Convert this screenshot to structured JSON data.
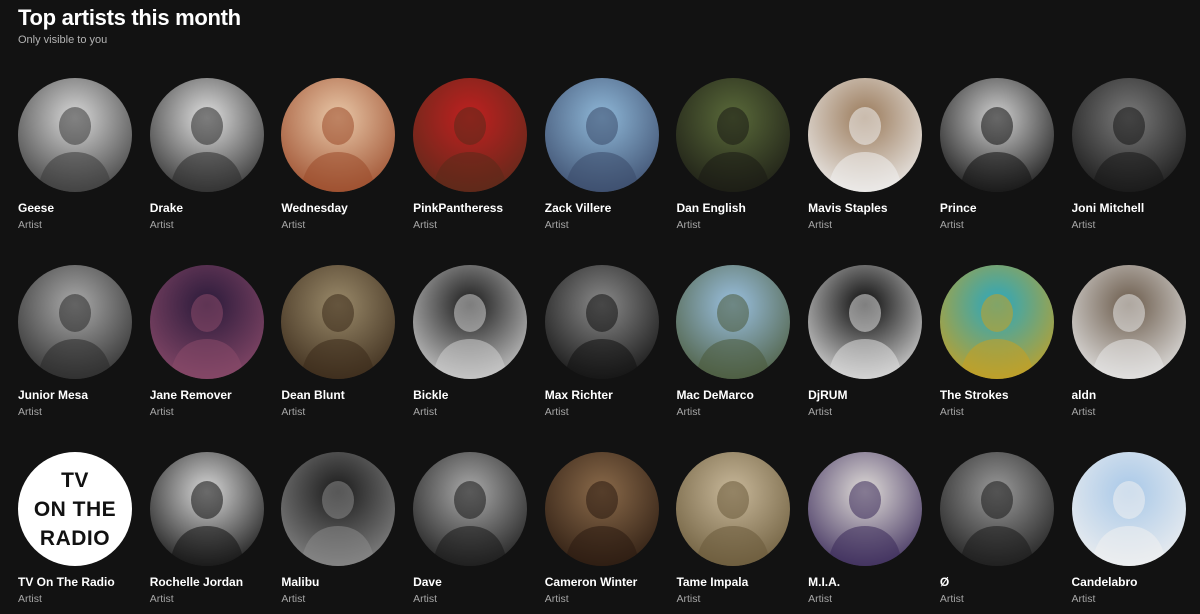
{
  "header": {
    "title": "Top artists this month",
    "subtitle": "Only visible to you"
  },
  "artists": [
    {
      "name": "Geese",
      "type": "Artist",
      "art": "photo",
      "colors": [
        "#d8d8d8",
        "#3a3a3a"
      ]
    },
    {
      "name": "Drake",
      "type": "Artist",
      "art": "photo",
      "colors": [
        "#e0e0e0",
        "#2a2a2a"
      ]
    },
    {
      "name": "Wednesday",
      "type": "Artist",
      "art": "photo",
      "colors": [
        "#e9c8a8",
        "#9a4a2a"
      ]
    },
    {
      "name": "PinkPantheress",
      "type": "Artist",
      "art": "photo",
      "colors": [
        "#c02020",
        "#5a2a1a"
      ]
    },
    {
      "name": "Zack Villere",
      "type": "Artist",
      "art": "photo",
      "colors": [
        "#8fb8d8",
        "#3a4a6a"
      ]
    },
    {
      "name": "Dan English",
      "type": "Artist",
      "art": "photo",
      "colors": [
        "#5a6a3a",
        "#1a1a14"
      ]
    },
    {
      "name": "Mavis Staples",
      "type": "Artist",
      "art": "photo",
      "colors": [
        "#9a7a5a",
        "#f0f0f0"
      ]
    },
    {
      "name": "Prince",
      "type": "Artist",
      "art": "photo",
      "colors": [
        "#d0d0d0",
        "#101010"
      ]
    },
    {
      "name": "Joni Mitchell",
      "type": "Artist",
      "art": "photo",
      "colors": [
        "#7a7a7a",
        "#151515"
      ]
    },
    {
      "name": "Junior Mesa",
      "type": "Artist",
      "art": "photo",
      "colors": [
        "#aaaaaa",
        "#2a2a2a"
      ]
    },
    {
      "name": "Jane Remover",
      "type": "Artist",
      "art": "photo",
      "colors": [
        "#2a1a3a",
        "#8a4a6a"
      ]
    },
    {
      "name": "Dean Blunt",
      "type": "Artist",
      "art": "photo",
      "colors": [
        "#9a8a6a",
        "#3a2a1a"
      ]
    },
    {
      "name": "Bickle",
      "type": "Artist",
      "art": "photo",
      "colors": [
        "#1a1a1a",
        "#d0d0d0"
      ]
    },
    {
      "name": "Max Richter",
      "type": "Artist",
      "art": "photo",
      "colors": [
        "#8a8a8a",
        "#101010"
      ]
    },
    {
      "name": "Mac DeMarco",
      "type": "Artist",
      "art": "photo",
      "colors": [
        "#9ac0e0",
        "#4a5a3a"
      ]
    },
    {
      "name": "DjRUM",
      "type": "Artist",
      "art": "photo",
      "colors": [
        "#0a0a0a",
        "#e0e0e0"
      ]
    },
    {
      "name": "The Strokes",
      "type": "Artist",
      "art": "photo",
      "colors": [
        "#2aa8c0",
        "#c8a020"
      ]
    },
    {
      "name": "aldn",
      "type": "Artist",
      "art": "photo",
      "colors": [
        "#6a5a4a",
        "#e8e8e8"
      ]
    },
    {
      "name": "TV On The Radio",
      "type": "Artist",
      "art": "logo",
      "logo_lines": [
        "TV",
        "ON THE",
        "RADIO"
      ],
      "colors": [
        "#ffffff",
        "#111111"
      ]
    },
    {
      "name": "Rochelle Jordan",
      "type": "Artist",
      "art": "photo",
      "colors": [
        "#d8d8d8",
        "#101010"
      ]
    },
    {
      "name": "Malibu",
      "type": "Artist",
      "art": "photo",
      "colors": [
        "#1a1a1a",
        "#8a8a8a"
      ]
    },
    {
      "name": "Dave",
      "type": "Artist",
      "art": "photo",
      "colors": [
        "#aaaaaa",
        "#181818"
      ]
    },
    {
      "name": "Cameron Winter",
      "type": "Artist",
      "art": "photo",
      "colors": [
        "#8a6a4a",
        "#2a1a10"
      ]
    },
    {
      "name": "Tame Impala",
      "type": "Artist",
      "art": "photo",
      "colors": [
        "#c8b89a",
        "#6a5a3a"
      ]
    },
    {
      "name": "M.I.A.",
      "type": "Artist",
      "art": "photo",
      "colors": [
        "#e0dcd8",
        "#3a2a5a"
      ]
    },
    {
      "name": "Ø",
      "type": "Artist",
      "art": "photo",
      "colors": [
        "#9a9a9a",
        "#1a1a1a"
      ]
    },
    {
      "name": "Candelabro",
      "type": "Artist",
      "art": "photo",
      "colors": [
        "#a8c8e8",
        "#f0f0f0"
      ]
    }
  ]
}
